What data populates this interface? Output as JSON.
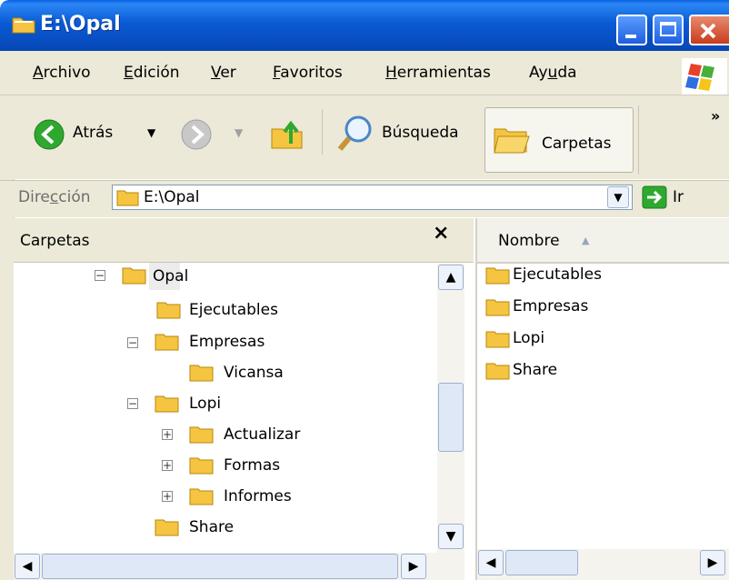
{
  "window": {
    "title": "E:\\Opal"
  },
  "menu": [
    {
      "pre": "",
      "u": "A",
      "post": "rchivo"
    },
    {
      "pre": "",
      "u": "E",
      "post": "dición"
    },
    {
      "pre": "",
      "u": "V",
      "post": "er"
    },
    {
      "pre": "",
      "u": "F",
      "post": "avoritos"
    },
    {
      "pre": "",
      "u": "H",
      "post": "erramientas"
    },
    {
      "pre": "Ay",
      "u": "u",
      "post": "da"
    }
  ],
  "toolbar": {
    "back_label": "Atrás",
    "search_label": "Búsqueda",
    "folders_label": "Carpetas",
    "overflow": "»"
  },
  "address": {
    "label_pre": "Dire",
    "label_u": "c",
    "label_post": "ción",
    "value": "E:\\Opal",
    "go_label": "Ir"
  },
  "folders_pane": {
    "title": "Carpetas",
    "close": "×",
    "tree": [
      {
        "label": "Opal",
        "expander": "−",
        "selected": true
      },
      {
        "label": "Ejecutables",
        "expander": ""
      },
      {
        "label": "Empresas",
        "expander": "−"
      },
      {
        "label": "Vicansa",
        "expander": ""
      },
      {
        "label": "Lopi",
        "expander": "−"
      },
      {
        "label": "Actualizar",
        "expander": "+"
      },
      {
        "label": "Formas",
        "expander": "+"
      },
      {
        "label": "Informes",
        "expander": "+"
      },
      {
        "label": "Share",
        "expander": ""
      }
    ]
  },
  "list": {
    "column": "Nombre",
    "items": [
      "Ejecutables",
      "Empresas",
      "Lopi",
      "Share"
    ]
  },
  "colors": {
    "titlebar": "#0a5ad4",
    "chrome": "#ece9d8",
    "folder": "#f5c542",
    "go_green": "#2fa82f"
  }
}
